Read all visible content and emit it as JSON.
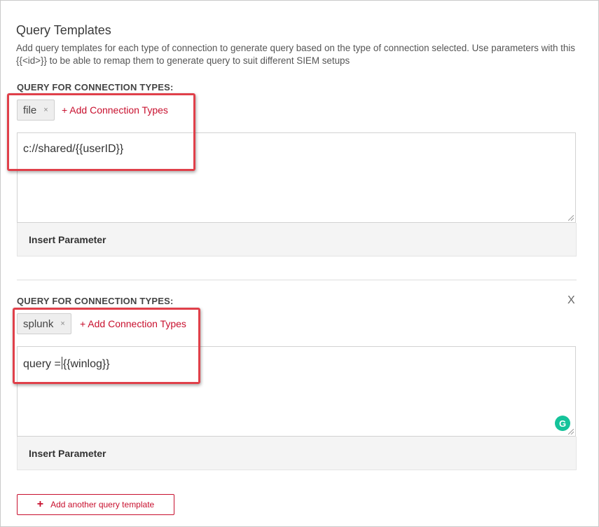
{
  "panel": {
    "title": "Query Templates",
    "description": "Add query templates for each type of connection to generate query based on the type of connection selected. Use parameters with this {{<id>}} to be able to remap them to generate query to suit different SIEM setups"
  },
  "templates": [
    {
      "label": "QUERY FOR CONNECTION TYPES:",
      "chip": "file",
      "chip_close": "×",
      "add_link": "+ Add Connection Types",
      "query": "c://shared/{{userID}}",
      "insert_parameter": "Insert Parameter"
    },
    {
      "label": "QUERY FOR CONNECTION TYPES:",
      "chip": "splunk",
      "chip_close": "×",
      "add_link": "+ Add Connection Types",
      "query_before_caret": "query =",
      "query_after_caret": "{{winlog}}",
      "insert_parameter": "Insert Parameter",
      "remove": "X"
    }
  ],
  "add_template": {
    "icon": "+",
    "label": "Add another query template"
  },
  "colors": {
    "accent": "#c8102e",
    "highlight": "#e0404a",
    "grammarly": "#15c39a"
  }
}
